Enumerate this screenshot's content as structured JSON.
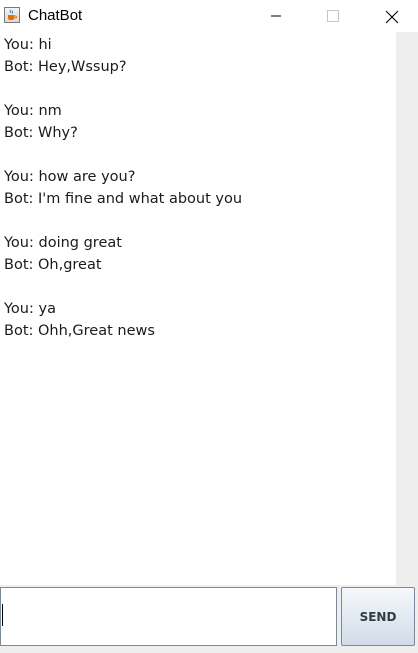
{
  "window": {
    "title": "ChatBot",
    "app_icon": "java-cup-icon"
  },
  "chat": {
    "messages": [
      "You: hi",
      "Bot: Hey,Wssup?",
      "You: nm",
      "Bot: Why?",
      "You: how are you?",
      "Bot: I'm fine and what about you",
      "You: doing great",
      "Bot: Oh,great",
      "You: ya",
      "Bot: Ohh,Great news"
    ]
  },
  "input": {
    "value": "",
    "placeholder": ""
  },
  "send_button": {
    "label": "SEND"
  },
  "colors": {
    "window_bg": "#ffffff",
    "panel_gray": "#eeeeee",
    "text": "#1b1b1b",
    "border": "#7a8a9a"
  }
}
